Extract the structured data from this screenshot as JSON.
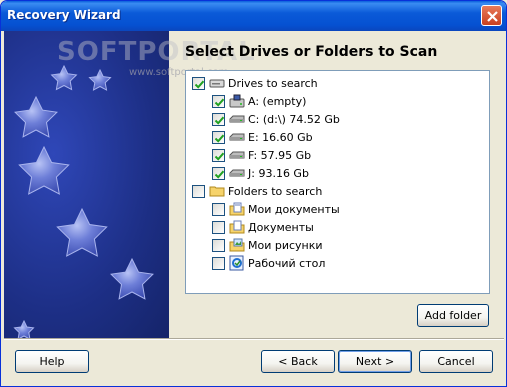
{
  "window": {
    "title": "Recovery Wizard"
  },
  "watermark": {
    "main": "SOFTPORTAL",
    "sub": "www.softportal.com"
  },
  "heading": "Select Drives or Folders to Scan",
  "tree": {
    "drives": {
      "label": "Drives to search",
      "checked": true,
      "items": [
        {
          "label": "A: (empty)",
          "checked": true,
          "icon": "floppy-drive-icon"
        },
        {
          "label": "C: (d:\\) 74.52 Gb",
          "checked": true,
          "icon": "hard-drive-icon"
        },
        {
          "label": "E: 16.60 Gb",
          "checked": true,
          "icon": "hard-drive-icon"
        },
        {
          "label": "F: 57.95 Gb",
          "checked": true,
          "icon": "hard-drive-icon"
        },
        {
          "label": "J: 93.16 Gb",
          "checked": true,
          "icon": "hard-drive-icon"
        }
      ]
    },
    "folders": {
      "label": "Folders to search",
      "checked": false,
      "items": [
        {
          "label": "Мои документы",
          "checked": false,
          "icon": "my-documents-folder-icon"
        },
        {
          "label": "Документы",
          "checked": false,
          "icon": "documents-folder-icon"
        },
        {
          "label": "Мои рисунки",
          "checked": false,
          "icon": "my-pictures-folder-icon"
        },
        {
          "label": "Рабочий стол",
          "checked": false,
          "icon": "desktop-icon"
        }
      ]
    }
  },
  "buttons": {
    "add_folder": "Add folder",
    "help": "Help",
    "back": "< Back",
    "next": "Next >",
    "cancel": "Cancel"
  },
  "colors": {
    "titlebar": "#0551d2",
    "sidebar": "#1d2f86",
    "star": "#7f8fdf",
    "face": "#ece9d8"
  }
}
